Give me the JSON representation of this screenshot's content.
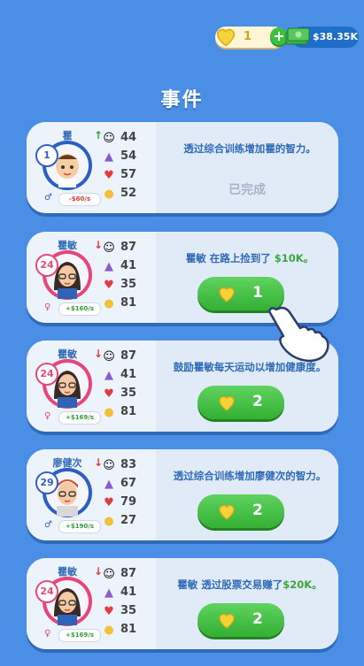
{
  "topbar": {
    "hearts": "1",
    "money": "$38.35K"
  },
  "title": "事件",
  "cards": [
    {
      "name": "瞿",
      "age": "1",
      "gender": "male",
      "income": "-$60/s",
      "trend": "up",
      "stats": [
        "44",
        "54",
        "57",
        "52"
      ],
      "message": "透过综合训练增加瞿的智力。",
      "status": "已完成"
    },
    {
      "name": "瞿敏",
      "age": "24",
      "gender": "female",
      "income": "+$160/s",
      "trend": "down",
      "stats": [
        "87",
        "41",
        "35",
        "81"
      ],
      "message_pre": "瞿敏 在路上捡到了",
      "message_highlight": "$10K。",
      "cost": "1"
    },
    {
      "name": "瞿敏",
      "age": "24",
      "gender": "female",
      "income": "+$169/s",
      "trend": "down",
      "stats": [
        "87",
        "41",
        "35",
        "81"
      ],
      "message": "鼓励瞿敏每天运动以增加健康度。",
      "cost": "2"
    },
    {
      "name": "廖健次",
      "age": "29",
      "gender": "male",
      "income": "+$190/s",
      "trend": "down",
      "stats": [
        "83",
        "67",
        "79",
        "27"
      ],
      "message": "透过综合训练增加廖健次的智力。",
      "cost": "2"
    },
    {
      "name": "瞿敏",
      "age": "24",
      "gender": "female",
      "income": "+$169/s",
      "trend": "down",
      "stats": [
        "87",
        "41",
        "35",
        "81"
      ],
      "message_pre": "瞿敏 透过股票交易赚了",
      "message_highlight": "$20K。",
      "cost": "2"
    }
  ]
}
